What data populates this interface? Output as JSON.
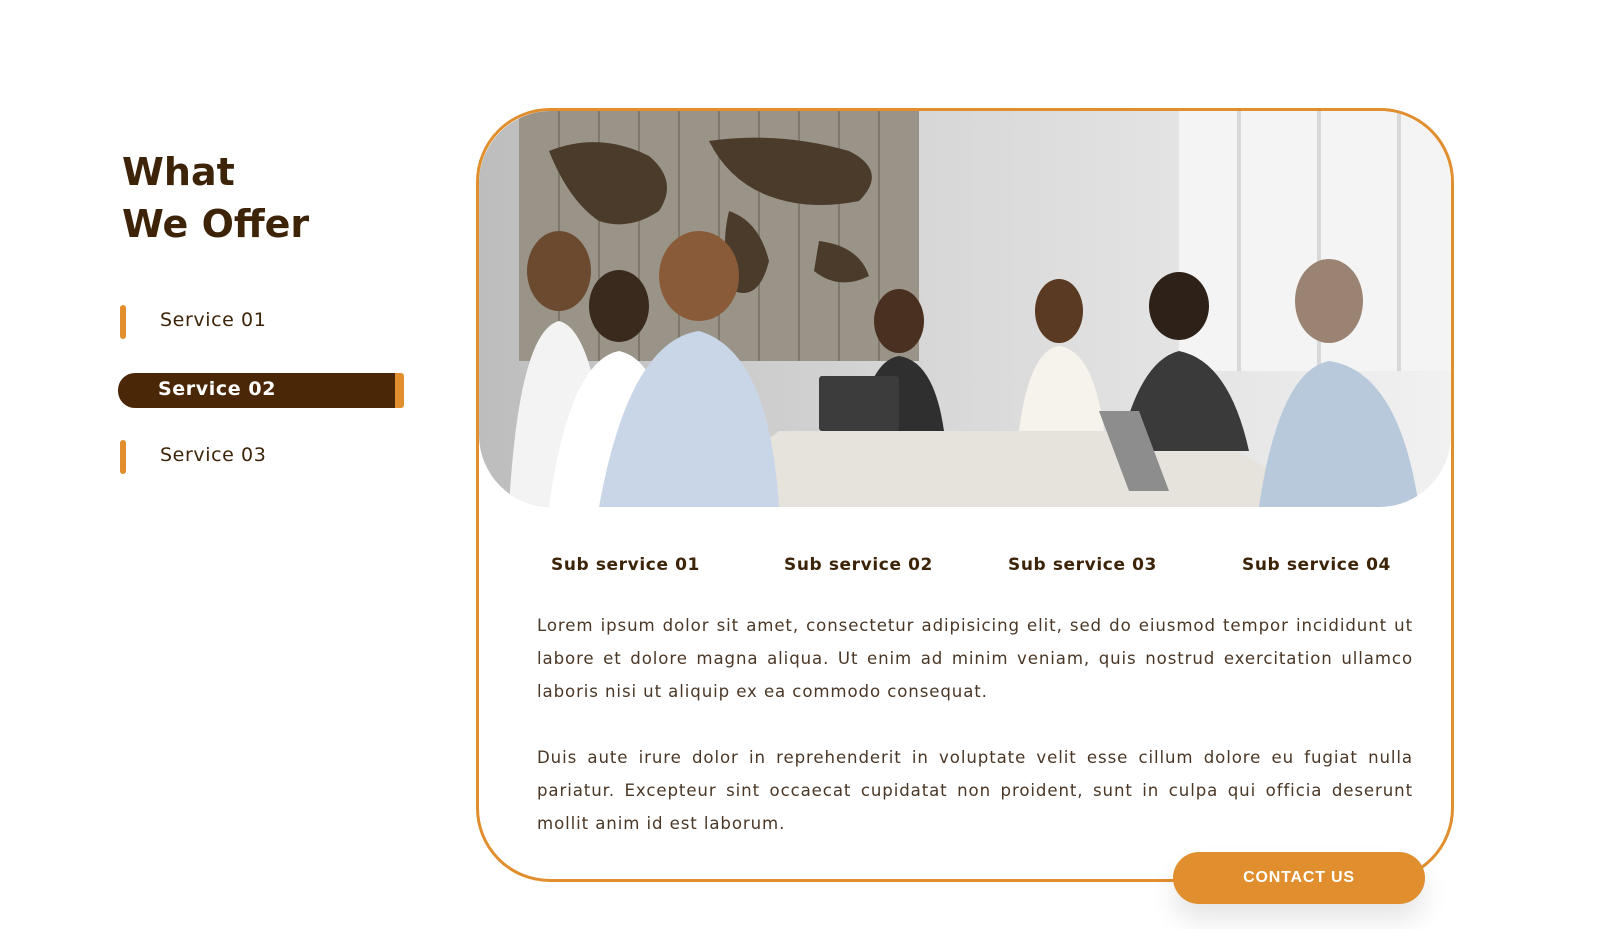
{
  "heading": {
    "line1": "What",
    "line2": "We Offer"
  },
  "services": [
    {
      "label": "Service 01",
      "active": false
    },
    {
      "label": "Service 02",
      "active": true
    },
    {
      "label": "Service 03",
      "active": false
    }
  ],
  "card": {
    "image_alt": "team meeting photo",
    "sub_services": [
      "Sub service 01",
      "Sub service 02",
      "Sub service 03",
      "Sub service 04"
    ],
    "paragraphs": [
      "Lorem ipsum dolor sit amet, consectetur adipisicing elit, sed do eiusmod tempor incididunt ut labore et dolore magna aliqua. Ut enim ad minim veniam, quis nostrud exercitation ullamco laboris nisi ut aliquip ex ea commodo consequat.",
      "Duis aute irure dolor in reprehenderit in voluptate velit esse cillum dolore eu fugiat nulla pariatur. Excepteur sint occaecat cupidatat non proident, sunt in culpa qui officia deserunt mollit anim id est laborum."
    ]
  },
  "contact_button": "CONTACT US",
  "colors": {
    "accent": "#e18e2e",
    "dark_brown": "#4a2706",
    "text_brown": "#3d2409"
  }
}
